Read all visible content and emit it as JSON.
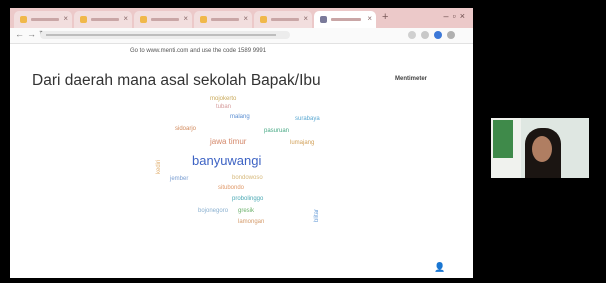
{
  "browser": {
    "tabs": [
      {
        "label": "",
        "active": false
      },
      {
        "label": "",
        "active": false
      },
      {
        "label": "",
        "active": false
      },
      {
        "label": "",
        "active": false
      },
      {
        "label": "",
        "active": false
      },
      {
        "label": "",
        "active": true
      }
    ],
    "address": ""
  },
  "presentation": {
    "instruction": "Go to www.menti.com and use the code 1589 9991",
    "question": "Dari daerah mana asal sekolah Bapak/Ibu",
    "brand": "Mentimeter"
  },
  "wordcloud": [
    {
      "text": "banyuwangi",
      "color": "#3d63c4"
    },
    {
      "text": "jawa timur",
      "color": "#d4886a"
    },
    {
      "text": "pasuruan",
      "color": "#46a884"
    },
    {
      "text": "mojokerto",
      "color": "#c9a95a"
    },
    {
      "text": "malang",
      "color": "#5b8ed2"
    },
    {
      "text": "sidoarjo",
      "color": "#d28a5c"
    },
    {
      "text": "surabaya",
      "color": "#5aa8d2"
    },
    {
      "text": "lumajang",
      "color": "#d2a15a"
    },
    {
      "text": "jember",
      "color": "#7a9ed2"
    },
    {
      "text": "situbondo",
      "color": "#e09a6a"
    },
    {
      "text": "probolinggo",
      "color": "#4aa8b4"
    },
    {
      "text": "bondowoso",
      "color": "#d6b87a"
    },
    {
      "text": "gresik",
      "color": "#6ab06a"
    },
    {
      "text": "tuban",
      "color": "#d59a9a"
    },
    {
      "text": "lamongan",
      "color": "#d49a6a"
    },
    {
      "text": "bojonegoro",
      "color": "#8ab0d0"
    },
    {
      "text": "kediri",
      "color": "#e2b070"
    },
    {
      "text": "blitar",
      "color": "#6a9ed8"
    }
  ],
  "participant": {
    "name": ""
  }
}
